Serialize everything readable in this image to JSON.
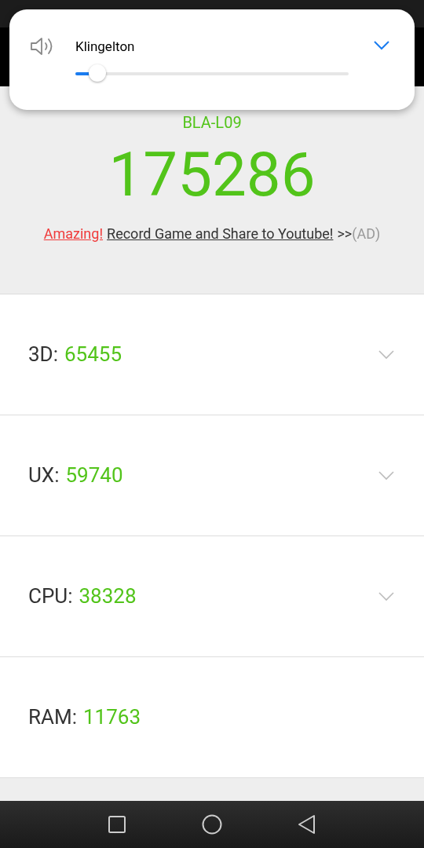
{
  "volume_panel": {
    "label": "Klingelton",
    "level": 0.08
  },
  "header": {
    "device": "BLA-L09",
    "score": "175286"
  },
  "ad": {
    "highlight": "Amazing!",
    "link": "Record Game and Share to Youtube!",
    "arrows": ">>",
    "tag": "(AD)"
  },
  "categories": [
    {
      "label": "3D:",
      "value": "65455",
      "expandable": true
    },
    {
      "label": "UX:",
      "value": "59740",
      "expandable": true
    },
    {
      "label": "CPU:",
      "value": "38328",
      "expandable": true
    },
    {
      "label": "RAM:",
      "value": "11763",
      "expandable": false
    }
  ]
}
